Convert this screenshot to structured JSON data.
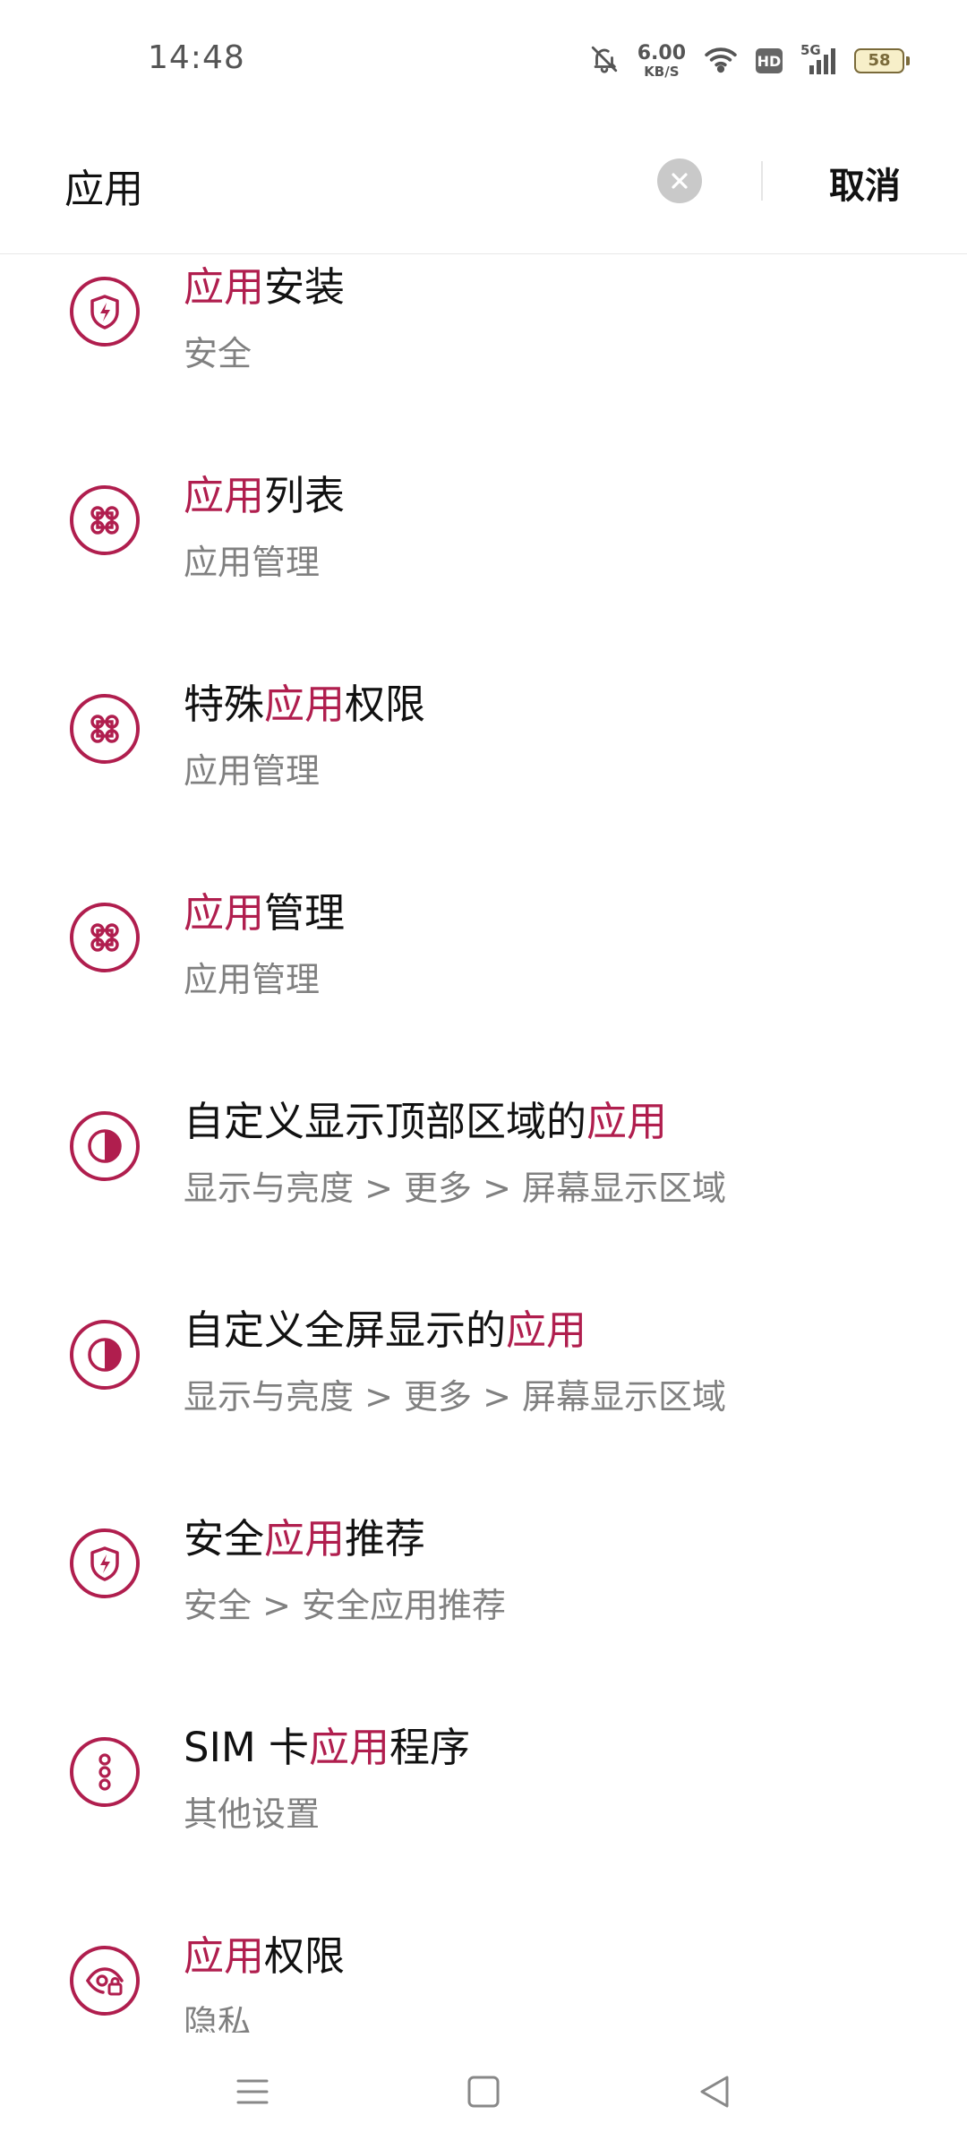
{
  "status_bar": {
    "time": "14:48",
    "net_speed_value": "6.00",
    "net_speed_unit": "KB/S",
    "hd_label": "HD",
    "network_type": "5G",
    "battery_level": "58",
    "icons": [
      "mute-bell-icon",
      "wifi-icon",
      "hd-icon",
      "signal-icon",
      "battery-icon"
    ]
  },
  "search": {
    "value": "应用",
    "cancel_label": "取消"
  },
  "theme": {
    "accent": "#b01e4e",
    "subtitle": "#808080"
  },
  "results": [
    {
      "icon": "shield-bolt-icon",
      "title_before": "",
      "title_match": "应用",
      "title_after": "安装",
      "subtitle": "安全"
    },
    {
      "icon": "command-icon",
      "title_before": "",
      "title_match": "应用",
      "title_after": "列表",
      "subtitle": "应用管理"
    },
    {
      "icon": "command-icon",
      "title_before": "特殊",
      "title_match": "应用",
      "title_after": "权限",
      "subtitle": "应用管理"
    },
    {
      "icon": "command-icon",
      "title_before": "",
      "title_match": "应用",
      "title_after": "管理",
      "subtitle": "应用管理"
    },
    {
      "icon": "contrast-icon",
      "title_before": "自定义显示顶部区域的",
      "title_match": "应用",
      "title_after": "",
      "subtitle": "显示与亮度 > 更多 > 屏幕显示区域"
    },
    {
      "icon": "contrast-icon",
      "title_before": "自定义全屏显示的",
      "title_match": "应用",
      "title_after": "",
      "subtitle": "显示与亮度 > 更多 > 屏幕显示区域"
    },
    {
      "icon": "shield-bolt-icon",
      "title_before": "安全",
      "title_match": "应用",
      "title_after": "推荐",
      "subtitle": "安全 > 安全应用推荐"
    },
    {
      "icon": "more-vertical-icon",
      "title_before": "SIM 卡",
      "title_match": "应用",
      "title_after": "程序",
      "subtitle": "其他设置"
    },
    {
      "icon": "privacy-eye-lock-icon",
      "title_before": "",
      "title_match": "应用",
      "title_after": "权限",
      "subtitle": "隐私"
    }
  ],
  "nav_bar": {
    "icons": [
      "menu-icon",
      "home-square-icon",
      "back-triangle-icon"
    ]
  }
}
